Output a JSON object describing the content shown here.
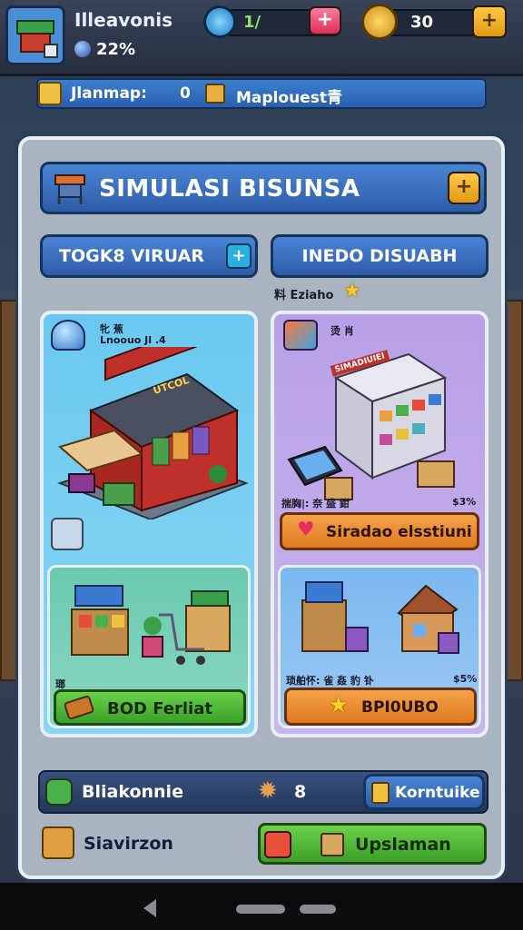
{
  "hud": {
    "player_name": "Illeavonis",
    "player_stat": "22%",
    "timer_value": "1/",
    "coin_value": "30",
    "add_icon": "+"
  },
  "quest": {
    "label": "Jlanmap:",
    "value": "0",
    "name": "Maplouest青"
  },
  "panel": {
    "title": "SIMULASI BISUNSA",
    "title_button": "+",
    "tab_left": "TOGK8 VIRUAR",
    "tab_left_plus": "+",
    "tab_right": "INEDO DISUABH",
    "tab_right_sub": "料 Eziaho"
  },
  "cards": {
    "left": {
      "label_top": "牝 蕉",
      "label_sub": "Lnoouo Jl .4",
      "store_sign": "UTCOL",
      "sub_stat_left": "瑯",
      "button": "BOD Ferliat"
    },
    "right": {
      "label_top": "烫 肖",
      "store_sign": "SIMADIUIEI",
      "stat_left": "揣胸|: 奈 盛 鉗",
      "stat_right": "$3%",
      "button": "Siradao elsstiuni",
      "sub_stat_left": "琐舶怀: 雀 姦 豹 钋",
      "sub_stat_right": "$5%",
      "sub_button": "BPI0UBO"
    }
  },
  "bottom": {
    "row1_label": "Bliakonnie",
    "row1_value": "8",
    "row1_button": "Korntuike",
    "row2_label": "Siavirzon",
    "row2_button": "Upslaman"
  }
}
